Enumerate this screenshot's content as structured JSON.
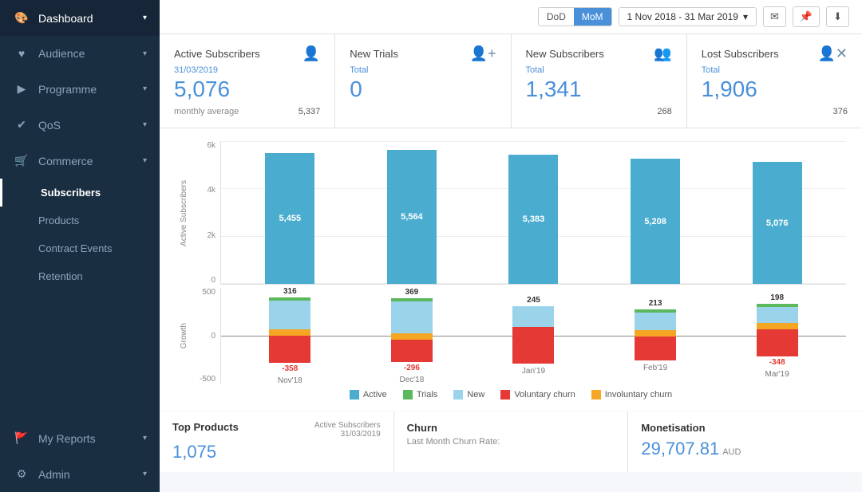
{
  "sidebar": {
    "items": [
      {
        "id": "dashboard",
        "label": "Dashboard",
        "icon": "🎨",
        "hasArrow": true,
        "active": false
      },
      {
        "id": "audience",
        "label": "Audience",
        "icon": "♥",
        "hasArrow": true,
        "active": false
      },
      {
        "id": "programme",
        "label": "Programme",
        "icon": "🎬",
        "hasArrow": true,
        "active": false
      },
      {
        "id": "qos",
        "label": "QoS",
        "icon": "✔",
        "hasArrow": true,
        "active": false
      },
      {
        "id": "commerce",
        "label": "Commerce",
        "icon": "🛒",
        "hasArrow": true,
        "active": false
      },
      {
        "id": "subscribers",
        "label": "Subscribers",
        "icon": "",
        "hasArrow": false,
        "active": true
      },
      {
        "id": "products",
        "label": "Products",
        "icon": "",
        "hasArrow": false,
        "active": false
      },
      {
        "id": "contract-events",
        "label": "Contract Events",
        "icon": "",
        "hasArrow": false,
        "active": false
      },
      {
        "id": "retention",
        "label": "Retention",
        "icon": "",
        "hasArrow": false,
        "active": false
      },
      {
        "id": "my-reports",
        "label": "My Reports",
        "icon": "🚩",
        "hasArrow": true,
        "active": false
      },
      {
        "id": "admin",
        "label": "Admin",
        "icon": "⚙",
        "hasArrow": true,
        "active": false
      }
    ]
  },
  "header": {
    "dod_label": "DoD",
    "mom_label": "MoM",
    "date_range": "1 Nov 2018 - 31 Mar 2019",
    "active_toggle": "MoM"
  },
  "stat_cards": [
    {
      "title": "Active Subscribers",
      "icon": "👤",
      "date_label": "31/03/2019",
      "value": "5,076",
      "sub_label": "monthly average",
      "sub_value": "5,337"
    },
    {
      "title": "New Trials",
      "icon": "👤+",
      "label": "Total",
      "value": "0",
      "sub_value": ""
    },
    {
      "title": "New Subscribers",
      "icon": "👥",
      "label": "Total",
      "value": "1,341",
      "sub_value": "268"
    },
    {
      "title": "Lost Subscribers",
      "icon": "👤x",
      "label": "Total",
      "value": "1,906",
      "sub_value": "376"
    }
  ],
  "bar_chart": {
    "y_axis": [
      "6k",
      "4k",
      "2k",
      "0"
    ],
    "y_label": "Active Subscribers",
    "bars": [
      {
        "month": "Nov'18",
        "value": 5455,
        "height_pct": 91,
        "label": "5,455"
      },
      {
        "month": "Dec'18",
        "value": 5564,
        "height_pct": 93,
        "label": "5,564"
      },
      {
        "month": "Jan'19",
        "value": 5383,
        "height_pct": 90,
        "label": "5,383"
      },
      {
        "month": "Feb'19",
        "value": 5208,
        "height_pct": 87,
        "label": "5,208"
      },
      {
        "month": "Mar'19",
        "value": 5076,
        "height_pct": 85,
        "label": "5,076"
      }
    ]
  },
  "growth_chart": {
    "y_axis": [
      "500",
      "0",
      "-500"
    ],
    "y_label": "Growth",
    "bars": [
      {
        "month": "Nov'18",
        "pos_label": "316",
        "neg_label": "-358",
        "pos_height": 36,
        "neg_height": 40,
        "has_trials": true,
        "has_inv_churn": true
      },
      {
        "month": "Dec'18",
        "pos_label": "369",
        "neg_label": "-296",
        "pos_height": 42,
        "neg_height": 34,
        "has_trials": true,
        "has_inv_churn": true
      },
      {
        "month": "Jan'19",
        "pos_label": "245",
        "neg_label": null,
        "neg_label_val": "",
        "pos_height": 28,
        "neg_height": 50,
        "has_trials": false,
        "has_inv_churn": false
      },
      {
        "month": "Feb'19",
        "pos_label": "213",
        "neg_label": null,
        "pos_height": 24,
        "neg_height": 36,
        "has_trials": true,
        "has_inv_churn": true
      },
      {
        "month": "Mar'19",
        "pos_label": "198",
        "neg_label": "-348",
        "pos_height": 22,
        "neg_height": 40,
        "has_trials": true,
        "has_inv_churn": true
      }
    ]
  },
  "legend": [
    {
      "label": "Active",
      "color": "#5bc0de"
    },
    {
      "label": "Trials",
      "color": "#5cb85c"
    },
    {
      "label": "New",
      "color": "#9ad3ea"
    },
    {
      "label": "Voluntary churn",
      "color": "#e53935"
    },
    {
      "label": "Involuntary churn",
      "color": "#f5a623"
    }
  ],
  "bottom_section": [
    {
      "title": "Top Products",
      "date": "Active Subscribers\n31/03/2019",
      "value": "1,075",
      "sub": ""
    },
    {
      "title": "Churn",
      "date": "",
      "value": "",
      "sub": "Last Month Churn Rate:"
    },
    {
      "title": "Monetisation",
      "date": "",
      "value": "29,707.81",
      "sub": "AUD"
    }
  ]
}
